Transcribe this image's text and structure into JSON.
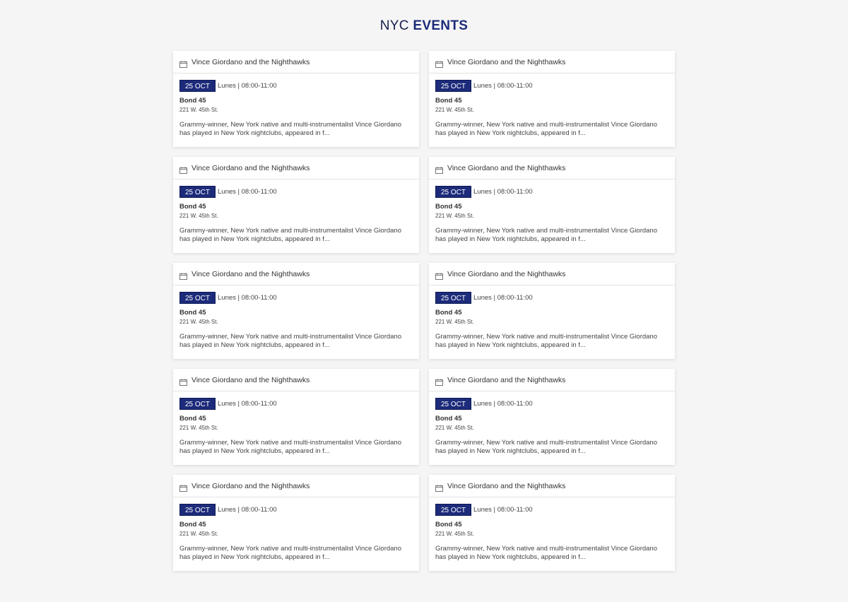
{
  "header": {
    "title_plain": "NYC",
    "title_strong": "EVENTS"
  },
  "colors": {
    "accent": "#1c2b7a",
    "background": "#f5f5f5",
    "card": "#ffffff"
  },
  "events": [
    {
      "icon": "calendar-icon",
      "title": "Vince Giordano and the Nighthawks",
      "date": "25 OCT",
      "schedule": "Lunes | 08:00-11:00",
      "venue": "Bond 45",
      "address": "221 W. 45th St.",
      "description": "Grammy-winner, New York native and multi-instrumentalist Vince Giordano has played in New York nightclubs, appeared in f..."
    },
    {
      "icon": "calendar-icon",
      "title": "Vince Giordano and the Nighthawks",
      "date": "25 OCT",
      "schedule": "Lunes | 08:00-11:00",
      "venue": "Bond 45",
      "address": "221 W. 45th St.",
      "description": "Grammy-winner, New York native and multi-instrumentalist Vince Giordano has played in New York nightclubs, appeared in f..."
    },
    {
      "icon": "calendar-icon",
      "title": "Vince Giordano and the Nighthawks",
      "date": "25 OCT",
      "schedule": "Lunes | 08:00-11:00",
      "venue": "Bond 45",
      "address": "221 W. 45th St.",
      "description": "Grammy-winner, New York native and multi-instrumentalist Vince Giordano has played in New York nightclubs, appeared in f..."
    },
    {
      "icon": "calendar-icon",
      "title": "Vince Giordano and the Nighthawks",
      "date": "25 OCT",
      "schedule": "Lunes | 08:00-11:00",
      "venue": "Bond 45",
      "address": "221 W. 45th St.",
      "description": "Grammy-winner, New York native and multi-instrumentalist Vince Giordano has played in New York nightclubs, appeared in f..."
    },
    {
      "icon": "calendar-icon",
      "title": "Vince Giordano and the Nighthawks",
      "date": "25 OCT",
      "schedule": "Lunes | 08:00-11:00",
      "venue": "Bond 45",
      "address": "221 W. 45th St.",
      "description": "Grammy-winner, New York native and multi-instrumentalist Vince Giordano has played in New York nightclubs, appeared in f..."
    },
    {
      "icon": "calendar-icon",
      "title": "Vince Giordano and the Nighthawks",
      "date": "25 OCT",
      "schedule": "Lunes | 08:00-11:00",
      "venue": "Bond 45",
      "address": "221 W. 45th St.",
      "description": "Grammy-winner, New York native and multi-instrumentalist Vince Giordano has played in New York nightclubs, appeared in f..."
    },
    {
      "icon": "calendar-icon",
      "title": "Vince Giordano and the Nighthawks",
      "date": "25 OCT",
      "schedule": "Lunes | 08:00-11:00",
      "venue": "Bond 45",
      "address": "221 W. 45th St.",
      "description": "Grammy-winner, New York native and multi-instrumentalist Vince Giordano has played in New York nightclubs, appeared in f..."
    },
    {
      "icon": "calendar-icon",
      "title": "Vince Giordano and the Nighthawks",
      "date": "25 OCT",
      "schedule": "Lunes | 08:00-11:00",
      "venue": "Bond 45",
      "address": "221 W. 45th St.",
      "description": "Grammy-winner, New York native and multi-instrumentalist Vince Giordano has played in New York nightclubs, appeared in f..."
    },
    {
      "icon": "calendar-icon",
      "title": "Vince Giordano and the Nighthawks",
      "date": "25 OCT",
      "schedule": "Lunes | 08:00-11:00",
      "venue": "Bond 45",
      "address": "221 W. 45th St.",
      "description": "Grammy-winner, New York native and multi-instrumentalist Vince Giordano has played in New York nightclubs, appeared in f..."
    },
    {
      "icon": "calendar-icon",
      "title": "Vince Giordano and the Nighthawks",
      "date": "25 OCT",
      "schedule": "Lunes | 08:00-11:00",
      "venue": "Bond 45",
      "address": "221 W. 45th St.",
      "description": "Grammy-winner, New York native and multi-instrumentalist Vince Giordano has played in New York nightclubs, appeared in f..."
    }
  ]
}
